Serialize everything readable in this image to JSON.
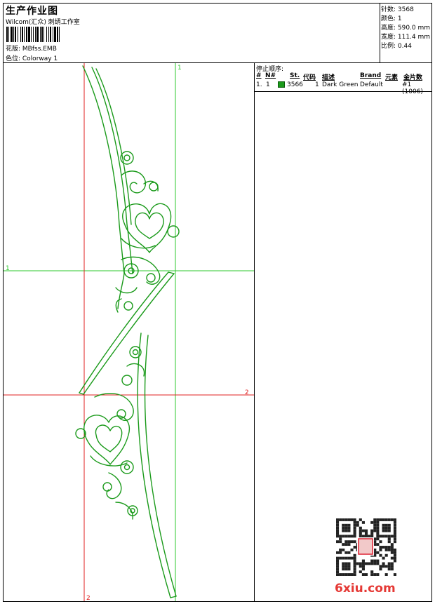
{
  "header": {
    "title": "生产作业图",
    "company": "Wilcom(汇众) 刺绣工作室",
    "design_line": "花版:  MBfss.EMB",
    "colorway_line": "色位:  Colorway 1"
  },
  "stats": [
    "针数: 3568",
    "颜色: 1",
    "高度: 590.0 mm",
    "宽度: 111.4 mm",
    "比例: 0.44"
  ],
  "canvas": {
    "guide_label_top": "1",
    "guide_label_left": "1",
    "guide_label_right": "2",
    "guide_label_bottom": "2",
    "colors": {
      "thread": "#1a9a1a",
      "guide_green": "#2ec82e",
      "guide_red": "#e02020"
    }
  },
  "stop_sequence": {
    "title": "停止顺序:",
    "columns": [
      "#",
      "N#",
      "St.",
      "代码",
      "描述",
      "Brand",
      "元素",
      "金片数"
    ],
    "rows": [
      {
        "num": "1.",
        "needle": "1",
        "stitches": "3566",
        "code": "1",
        "description": "Dark Green",
        "brand": "Default",
        "element": "#1 (1006)",
        "swatch": "#1a9a1a"
      }
    ]
  },
  "watermark": {
    "logo_text": "6xiu.com",
    "qr_icon": "qr-code-icon"
  }
}
